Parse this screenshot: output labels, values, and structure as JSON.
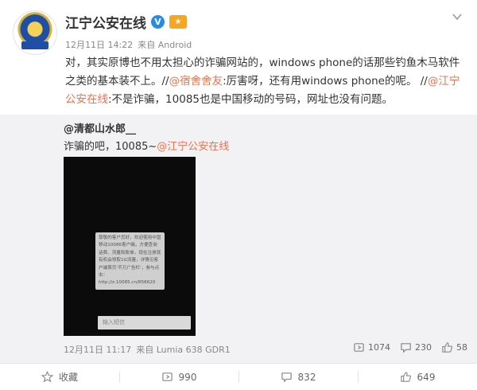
{
  "post": {
    "author": "江宁公安在线",
    "verified_mark": "V",
    "badge_icon": "gov-badge-icon",
    "date": "12月11日 14:22",
    "source_prefix": "来自",
    "source": "Android",
    "content": {
      "part1": "对，其实原博也不用太担心的诈骗网站的，windows phone的话那些钓鱼木马软件之类的基本装不上。//",
      "mention1": "@宿舍舍友",
      "part2": ":厉害呀，还有用windows phone的呢。 //",
      "mention2": "@江宁公安在线",
      "part3": ":不是诈骗，10085也是中国移动的号码，网址也没有问题。"
    }
  },
  "repost": {
    "author": "@清都山水郎__",
    "text_prefix": "诈骗的吧，10085~",
    "text_mention": "@江宁公安在线",
    "screenshot": {
      "sms_text": "尊敬的客户您好，欢迎使用中国移动10086客户端，方便查询话费、流量和账单。现在注册就有机会领取1G流量，详情见客户端首页‘不万广告栏’，参与点击：http://z.10085.cn/858620",
      "input_placeholder": "输入短信"
    },
    "date": "12月11日 11:17",
    "source_prefix": "来自",
    "source": "Lumia 638 GDR1",
    "reposts": "1074",
    "comments": "230",
    "likes": "58"
  },
  "footer": {
    "favorite_label": "收藏",
    "repost_count": "990",
    "comment_count": "832",
    "like_count": "649"
  },
  "colors": {
    "mention": "#eb7350",
    "verified": "#2a8cde",
    "repost_bg": "#f2f2f5"
  }
}
